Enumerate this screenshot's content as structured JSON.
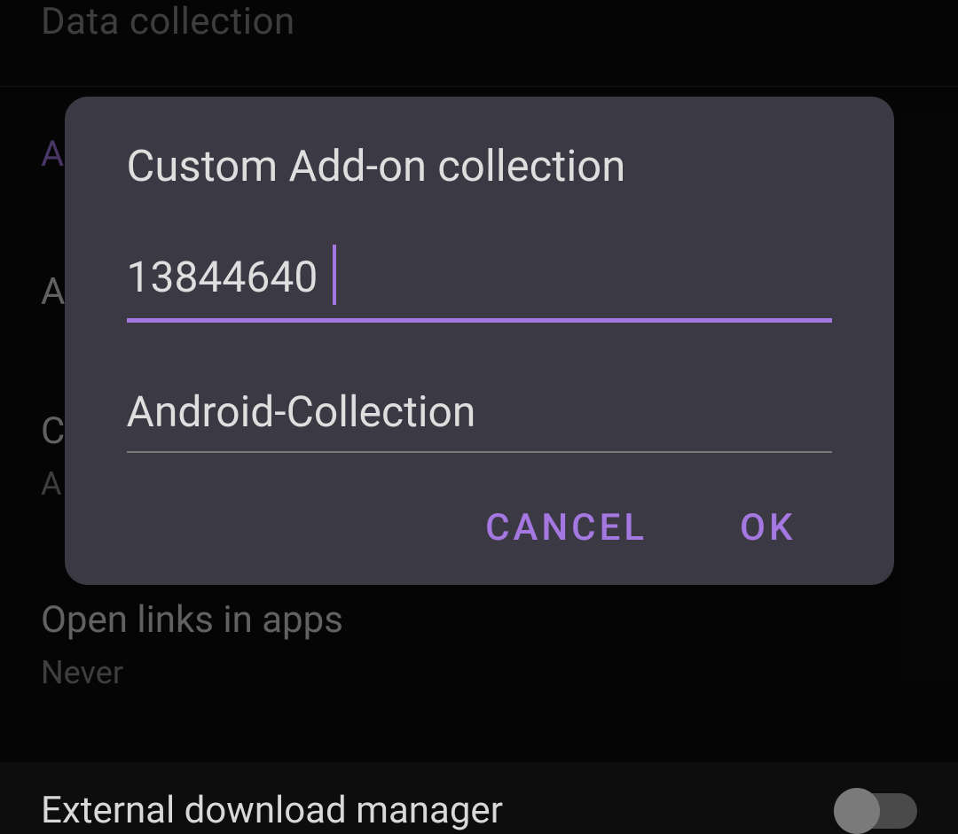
{
  "background": {
    "section_header": "Data collection",
    "accent_header": "A",
    "items": [
      {
        "title": "A"
      },
      {
        "title": "C",
        "subtitle": "A"
      },
      {
        "title": "Open links in apps",
        "subtitle": "Never"
      },
      {
        "title": "External download manager"
      }
    ]
  },
  "dialog": {
    "title": "Custom Add-on collection",
    "input_owner_value": "13844640",
    "input_owner_placeholder": "",
    "input_collection_value": "Android-Collection",
    "input_collection_placeholder": "",
    "cancel_label": "CANCEL",
    "ok_label": "OK"
  },
  "colors": {
    "accent": "#a478e0",
    "dialog_bg": "#3a3944",
    "text_primary": "#dedede",
    "text_secondary": "#8a8a8a"
  }
}
